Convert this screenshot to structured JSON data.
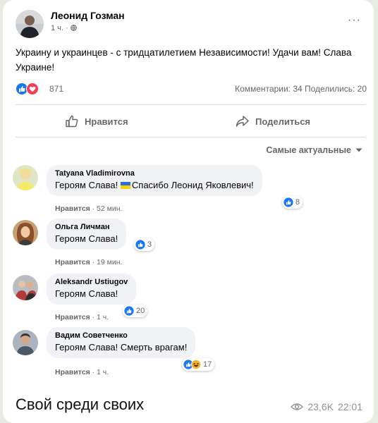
{
  "post": {
    "author": "Леонид Гозман",
    "time": "1 ч. ·",
    "more": "···",
    "text": "Украину и украинцев - с тридцатилетием Независимости! Удачи вам! Слава Украине!",
    "reaction_count": "871",
    "stats": "Комментарии: 34  Поделились: 20",
    "like_label": "Нравится",
    "share_label": "Поделиться",
    "sort_label": "Самые актуальные"
  },
  "comments": [
    {
      "name": "Tatyana Vladimirovna",
      "text_before": "Героям Слава!",
      "text_after": "Спасибо Леонид Яковлевич!",
      "like": "Нравится",
      "time": "· 52 мин.",
      "reactions": "8"
    },
    {
      "name": "Ольга Личман",
      "text": "Героям Слава!",
      "like": "Нравится",
      "time": "· 19 мин.",
      "reactions": "3"
    },
    {
      "name": "Aleksandr Ustiugov",
      "text": "Героям Слава!",
      "like": "Нравится",
      "time": "· 1 ч.",
      "reactions": "20"
    },
    {
      "name": "Вадим Советченко",
      "text": "Героям Слава! Смерть врагам!",
      "like": "Нравится",
      "time": "· 1 ч.",
      "reactions": "17"
    }
  ],
  "message": {
    "caption": "Свой среди своих",
    "views": "23,6K",
    "time": "22:01"
  },
  "colors": {
    "like_blue": "#1877f2",
    "love_red": "#f33e58",
    "muted_text": "#65676b",
    "comment_bg": "#f0f2f5"
  },
  "icons": [
    "avatar",
    "globe-icon",
    "like-icon",
    "love-icon",
    "haha-icon",
    "thumbs-up-icon",
    "share-arrow-icon",
    "sort-arrow-icon",
    "ukraine-flag-icon",
    "eye-icon"
  ]
}
